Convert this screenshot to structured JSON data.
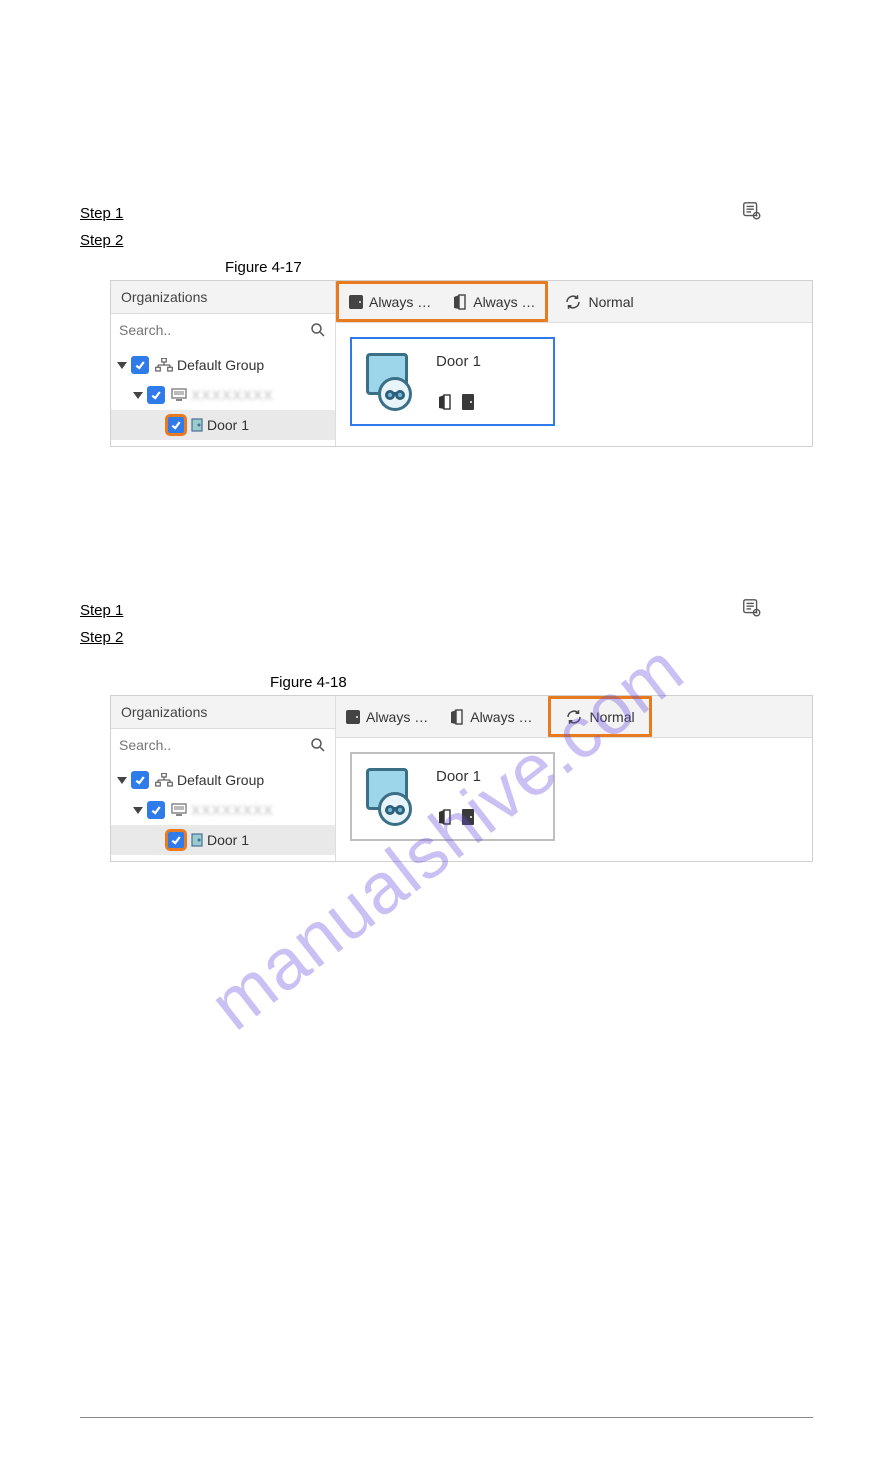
{
  "watermark": "manualshive.com",
  "section1": {
    "step1": "Step 1",
    "step2": "Step 2",
    "figure_label": "Figure 4-17",
    "panel": {
      "org_header": "Organizations",
      "search_placeholder": "Search..",
      "tree_root": "Default Group",
      "tree_door": "Door 1",
      "toolbar": {
        "always1": "Always …",
        "always2": "Always …",
        "normal": "Normal"
      },
      "door_card_title": "Door 1"
    }
  },
  "section2": {
    "step1": "Step 1",
    "step2": "Step 2",
    "figure_label": "Figure 4-18",
    "panel": {
      "org_header": "Organizations",
      "search_placeholder": "Search..",
      "tree_root": "Default Group",
      "tree_door": "Door 1",
      "toolbar": {
        "always1": "Always …",
        "always2": "Always …",
        "normal": "Normal"
      },
      "door_card_title": "Door 1"
    }
  }
}
